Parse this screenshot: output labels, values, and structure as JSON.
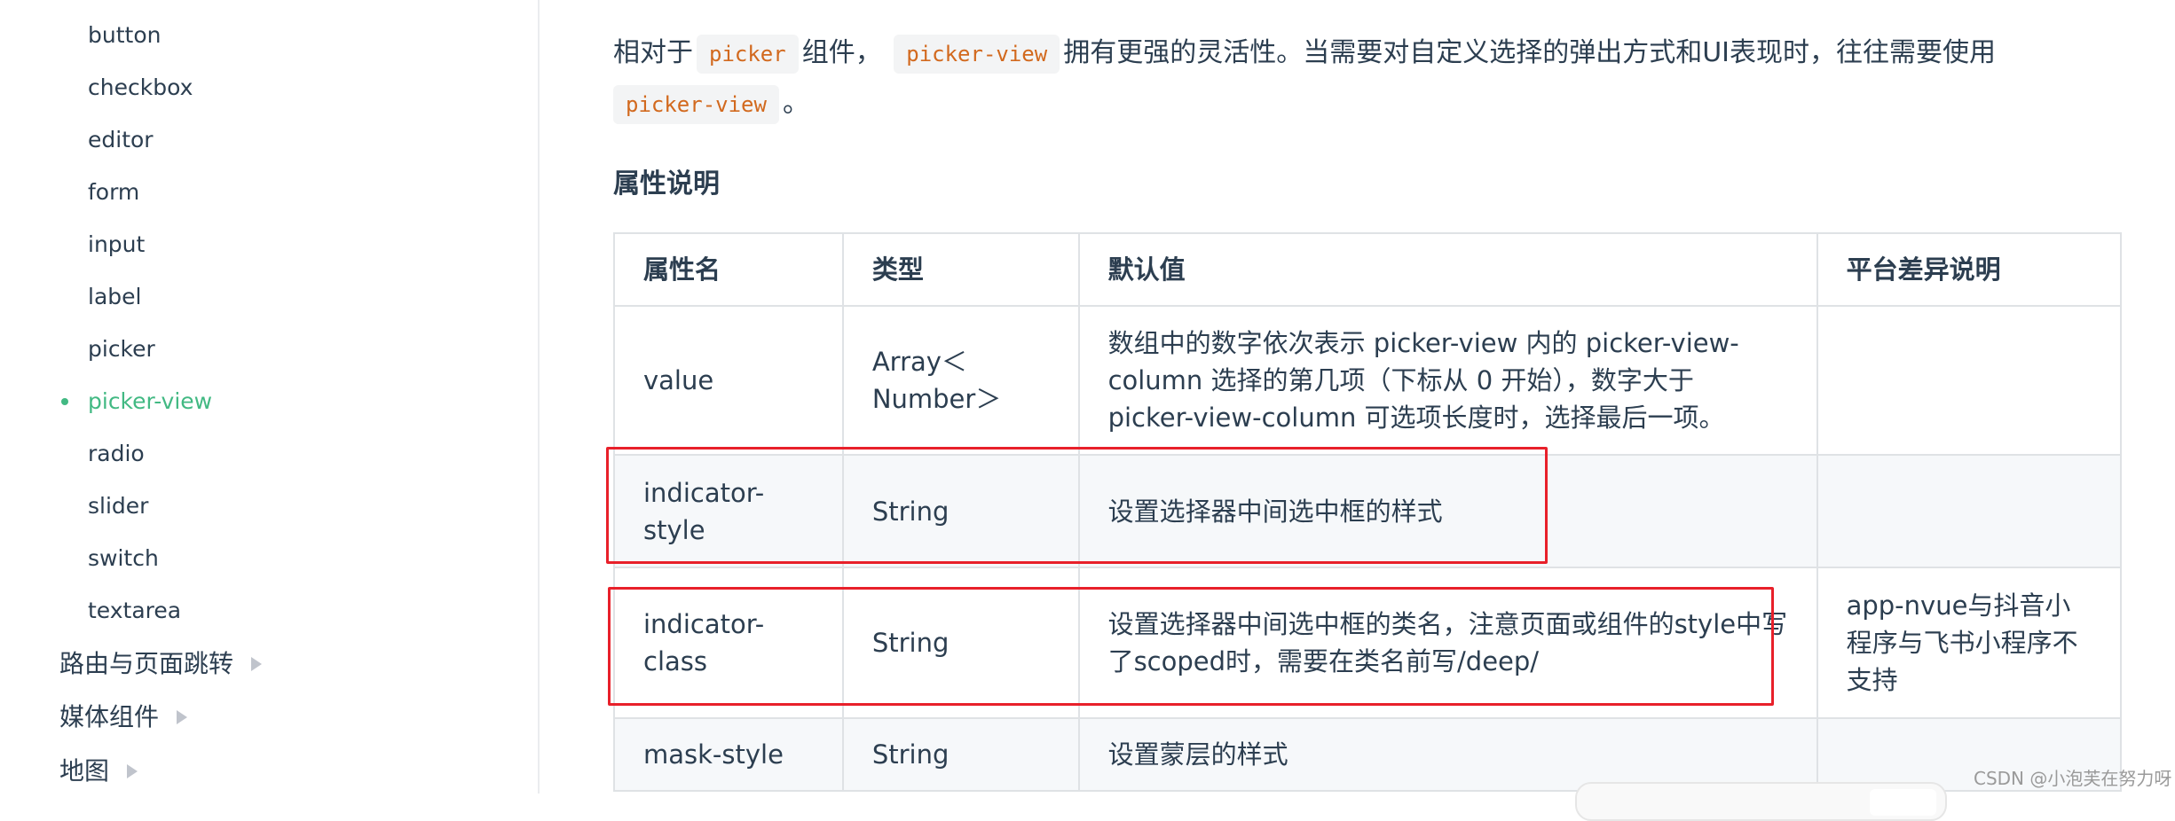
{
  "sidebar": {
    "items": [
      {
        "label": "button"
      },
      {
        "label": "checkbox"
      },
      {
        "label": "editor"
      },
      {
        "label": "form"
      },
      {
        "label": "input"
      },
      {
        "label": "label"
      },
      {
        "label": "picker"
      },
      {
        "label": "picker-view",
        "active": true
      },
      {
        "label": "radio"
      },
      {
        "label": "slider"
      },
      {
        "label": "switch"
      },
      {
        "label": "textarea"
      }
    ],
    "groups": [
      {
        "label": "路由与页面跳转",
        "icon": "caret-right-icon"
      },
      {
        "label": "媒体组件",
        "icon": "caret-right-icon"
      },
      {
        "label": "地图",
        "icon": "caret-right-icon"
      }
    ],
    "active_color": "#42b983"
  },
  "content": {
    "intro": {
      "t1": "相对于",
      "code1": "picker",
      "t2": "组件，",
      "code2": "picker-view",
      "t3": "拥有更强的灵活性。当需要对自定义选择的弹出方式和UI表现时，往往需要使用",
      "code3": "picker-view",
      "t4": "。"
    },
    "section_title": "属性说明",
    "table": {
      "headers": [
        "属性名",
        "类型",
        "默认值",
        "平台差异说明"
      ],
      "rows": [
        {
          "name": "value",
          "type": "Array＜Number＞",
          "desc": "数组中的数字依次表示 picker-view 内的 picker-view-column 选择的第几项（下标从 0 开始），数字大于 picker-view-column 可选项长度时，选择最后一项。",
          "platform": ""
        },
        {
          "name": "indicator-style",
          "type": "String",
          "desc": "设置选择器中间选中框的样式",
          "platform": ""
        },
        {
          "name": "indicator-class",
          "type": "String",
          "desc": "设置选择器中间选中框的类名，注意页面或组件的style中写了scoped时，需要在类名前写/deep/",
          "platform": "app-nvue与抖音小程序与飞书小程序不支持"
        },
        {
          "name": "mask-style",
          "type": "String",
          "desc": "设置蒙层的样式",
          "platform": ""
        }
      ]
    },
    "highlight_color": "#e8202a"
  },
  "watermark": "CSDN @小泡芙在努力呀"
}
